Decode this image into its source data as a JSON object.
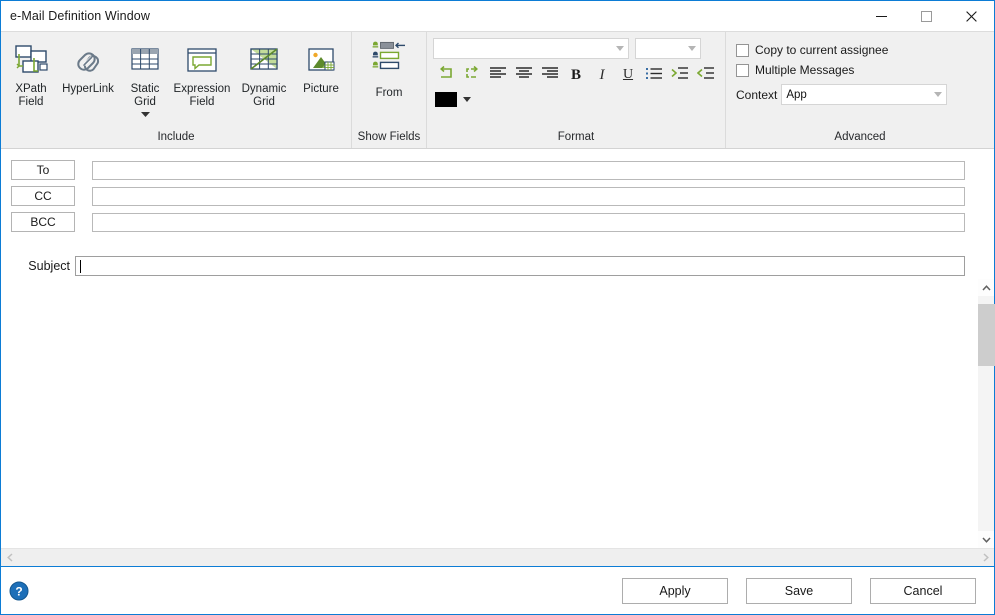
{
  "window": {
    "title": "e-Mail Definition Window",
    "accent_color": "#0c7cd5",
    "controls": {
      "minimize": "minimize-icon",
      "maximize": "maximize-icon",
      "close": "close-icon"
    }
  },
  "ribbon": {
    "groups": [
      {
        "label": "Include",
        "items": [
          {
            "label_line1": "XPath",
            "label_line2": "Field",
            "icon": "xpath-field-icon",
            "has_dropdown": false
          },
          {
            "label_line1": "HyperLink",
            "label_line2": "",
            "icon": "hyperlink-icon",
            "has_dropdown": false
          },
          {
            "label_line1": "Static",
            "label_line2": "Grid",
            "icon": "static-grid-icon",
            "has_dropdown": true
          },
          {
            "label_line1": "Expression",
            "label_line2": "Field",
            "icon": "expression-field-icon",
            "has_dropdown": false
          },
          {
            "label_line1": "Dynamic",
            "label_line2": "Grid",
            "icon": "dynamic-grid-icon",
            "has_dropdown": false
          },
          {
            "label_line1": "Picture",
            "label_line2": "",
            "icon": "picture-icon",
            "has_dropdown": false
          }
        ]
      },
      {
        "label": "Show Fields",
        "from_button": {
          "label": "From",
          "icon": "from-fields-icon"
        }
      },
      {
        "label": "Format",
        "font_family": {
          "value": "",
          "placeholder": ""
        },
        "font_size": {
          "value": "",
          "placeholder": ""
        },
        "buttons": [
          {
            "name": "undo-button",
            "icon": "undo-icon"
          },
          {
            "name": "redo-button",
            "icon": "redo-icon"
          },
          {
            "name": "align-left-button",
            "icon": "align-left-icon"
          },
          {
            "name": "align-center-button",
            "icon": "align-center-icon"
          },
          {
            "name": "align-right-button",
            "icon": "align-right-icon"
          },
          {
            "name": "bold-button",
            "icon": "bold-icon",
            "glyph": "B"
          },
          {
            "name": "italic-button",
            "icon": "italic-icon",
            "glyph": "I"
          },
          {
            "name": "underline-button",
            "icon": "underline-icon",
            "glyph": "U"
          },
          {
            "name": "bullet-list-button",
            "icon": "bullet-list-icon"
          },
          {
            "name": "increase-indent-button",
            "icon": "increase-indent-icon"
          },
          {
            "name": "decrease-indent-button",
            "icon": "decrease-indent-icon"
          }
        ],
        "color_swatch": "#000000"
      },
      {
        "label": "Advanced",
        "checkboxes": [
          {
            "label": "Copy to current assignee",
            "checked": false
          },
          {
            "label": "Multiple Messages",
            "checked": false
          }
        ],
        "context": {
          "label": "Context",
          "value": "App"
        }
      }
    ]
  },
  "fields": {
    "address_rows": [
      {
        "button": "To",
        "value": ""
      },
      {
        "button": "CC",
        "value": ""
      },
      {
        "button": "BCC",
        "value": ""
      }
    ],
    "subject": {
      "label": "Subject",
      "value": "",
      "caret_visible": true
    }
  },
  "body": {
    "content": ""
  },
  "scrollbars": {
    "vertical": {
      "up": "chevron-up-icon",
      "down": "chevron-down-icon",
      "thumb_top_pct": 4,
      "thumb_height_pct": 22
    },
    "horizontal": {
      "left": "chevron-left-icon",
      "right": "chevron-right-icon"
    }
  },
  "footer": {
    "help_icon": "help-icon",
    "buttons": [
      {
        "label": "Apply",
        "name": "apply-button"
      },
      {
        "label": "Save",
        "name": "save-button"
      },
      {
        "label": "Cancel",
        "name": "cancel-button"
      }
    ]
  },
  "colors": {
    "ribbon_bg": "#f0f0f0",
    "green_accent": "#7ba832",
    "navy_accent": "#2e4a6b",
    "border": "#d3d3d3"
  }
}
